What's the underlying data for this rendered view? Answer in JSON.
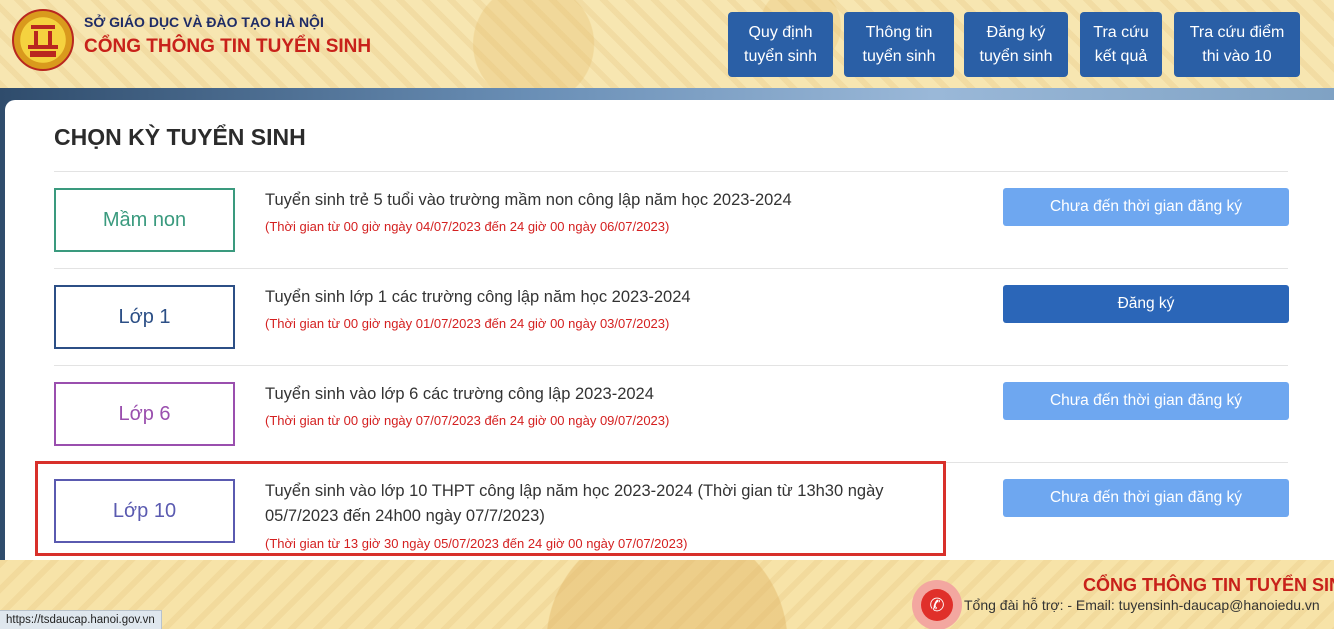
{
  "header": {
    "org_name": "SỞ GIÁO DỤC VÀ ĐÀO TẠO HÀ NỘI",
    "portal_name": "CỔNG THÔNG TIN TUYỂN SINH",
    "nav": [
      {
        "line1": "Quy định",
        "line2": "tuyển sinh"
      },
      {
        "line1": "Thông tin",
        "line2": "tuyển sinh"
      },
      {
        "line1": "Đăng ký",
        "line2": "tuyển sinh"
      },
      {
        "line1": "Tra cứu",
        "line2": "kết quả"
      },
      {
        "line1": "Tra cứu điểm",
        "line2": "thi vào 10"
      }
    ]
  },
  "main": {
    "title": "CHỌN KỲ TUYỂN SINH",
    "rows": [
      {
        "level": "Mầm non",
        "level_color": "#3a9a7e",
        "title": "Tuyển sinh trẻ 5 tuổi vào trường mầm non công lập năm học 2023-2024",
        "time": "(Thời gian từ 00 giờ ngày 04/07/2023 đến 24 giờ 00 ngày 06/07/2023)",
        "action": "Chưa đến thời gian đăng ký"
      },
      {
        "level": "Lớp 1",
        "level_color": "#2c4f86",
        "title": "Tuyển sinh lớp 1 các trường công lập năm học 2023-2024",
        "time": "(Thời gian từ 00 giờ ngày 01/07/2023 đến 24 giờ 00 ngày 03/07/2023)",
        "action": "Đăng ký"
      },
      {
        "level": "Lớp 6",
        "level_color": "#9a4fae",
        "title": "Tuyển sinh vào lớp 6 các trường công lập 2023-2024",
        "time": "(Thời gian từ 00 giờ ngày 07/07/2023 đến 24 giờ 00 ngày 09/07/2023)",
        "action": "Chưa đến thời gian đăng ký"
      },
      {
        "level": "Lớp 10",
        "level_color": "#5a5ab0",
        "title_line1": "Tuyển sinh vào lớp 10 THPT công lập năm học 2023-2024 (Thời gian từ 13h30 ngày",
        "title_line2": "05/7/2023 đến 24h00 ngày 07/7/2023)",
        "time": "(Thời gian từ 13 giờ 30 ngày 05/07/2023 đến 24 giờ 00 ngày 07/07/2023)",
        "action": "Chưa đến thời gian đăng ký"
      }
    ]
  },
  "footer": {
    "title": "CỔNG THÔNG TIN TUYỂN SINH",
    "hotline": "Tổng đài hỗ trợ: - Email: tuyensinh-daucap@hanoiedu.vn",
    "status_url": "https://tsdaucap.hanoi.gov.vn"
  },
  "colors": {
    "accent_blue": "#2a5fa6",
    "disabled_blue": "#6ea7f0",
    "alert_red": "#d42020"
  },
  "icons": [
    "logo-emblem-icon",
    "phone-icon"
  ]
}
